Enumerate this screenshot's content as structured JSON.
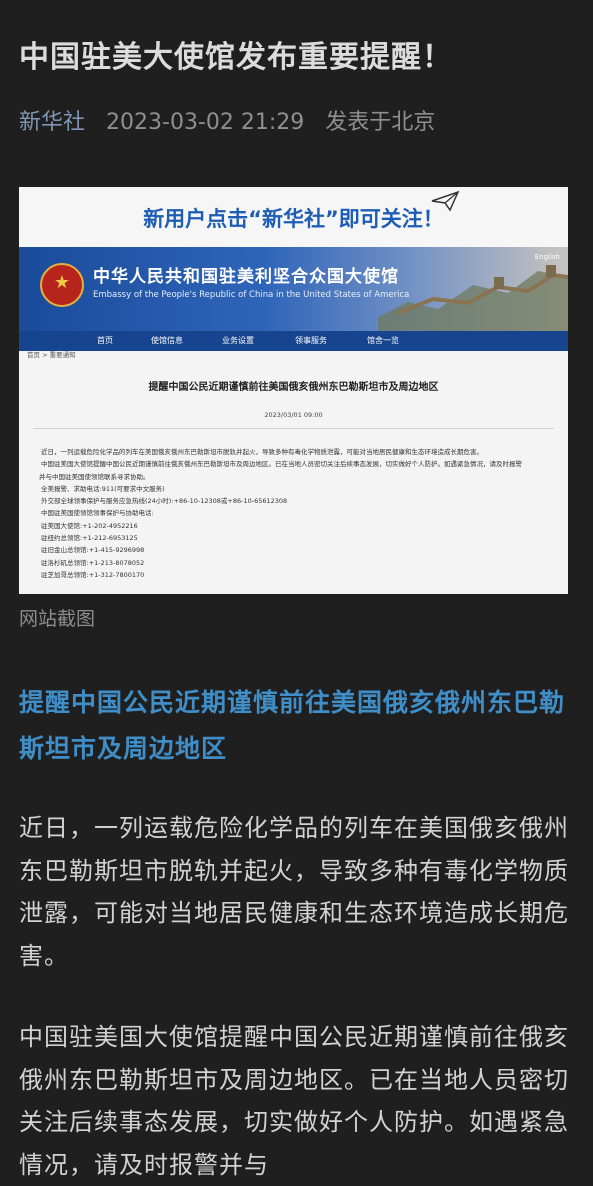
{
  "article": {
    "title": "中国驻美大使馆发布重要提醒！",
    "source": "新华社",
    "datetime": "2023-03-02 21:29",
    "location": "发表于北京",
    "caption": "网站截图",
    "subheading": "提醒中国公民近期谨慎前往美国俄亥俄州东巴勒斯坦市及周边地区",
    "paragraphs": [
      "近日，一列运载危险化学品的列车在美国俄亥俄州东巴勒斯坦市脱轨并起火，导致多种有毒化学物质泄露，可能对当地居民健康和生态环境造成长期危害。",
      "中国驻美国大使馆提醒中国公民近期谨慎前往俄亥俄州东巴勒斯坦市及周边地区。已在当地人员密切关注后续事态发展，切实做好个人防护。如遇紧急情况，请及时报警并与"
    ]
  },
  "screenshot": {
    "banner": "新用户点击“新华社”即可关注！",
    "english_link": "English",
    "embassy_cn": "中华人民共和国驻美利坚合众国大使馆",
    "embassy_en": "Embassy of the People's Republic of China in the United States of America",
    "nav": [
      "首页",
      "使馆信息",
      "业务设置",
      "领事服务",
      "馆舍一览"
    ],
    "breadcrumb": "首页 > 重要通知",
    "notice_title": "提醒中国公民近期谨慎前往美国俄亥俄州东巴勒斯坦市及周边地区",
    "notice_date": "2023/03/01 09:00",
    "lines": [
      "近日，一列运载危险化学品的列车在美国俄亥俄州东巴勒斯坦市脱轨并起火，导致多种有毒化学物质泄露，可能对当地居民健康和生态环境造成长期危害。",
      "中国驻美国大使馆提醒中国公民近期谨慎前往俄亥俄州东巴勒斯坦市及周边地区。已在当地人员密切关注后续事态发展，切实做好个人防护。如遇紧急情况，请及时报警",
      "并与中国驻美国使领馆联系寻求协助。",
      "全美报警、求助电话:911(可要求中文服务)",
      "外交部全球领事保护与服务应急热线(24小时):+86-10-12308或+86-10-65612308",
      "中国驻美国使领馆领事保护与协助电话:",
      "驻美国大使馆:+1-202-4952216",
      "驻纽约总领馆:+1-212-6953125",
      "驻旧金山总领馆:+1-415-9296998",
      "驻洛杉矶总领馆:+1-213-8078052",
      "驻芝加哥总领馆:+1-312-7800170"
    ]
  },
  "colors": {
    "background": "#1f1f1f",
    "subheading": "#3f8ec7",
    "source_link": "#7e95b4",
    "embassy_blue": "#1b4b9a",
    "banner_blue": "#1e5db5"
  }
}
